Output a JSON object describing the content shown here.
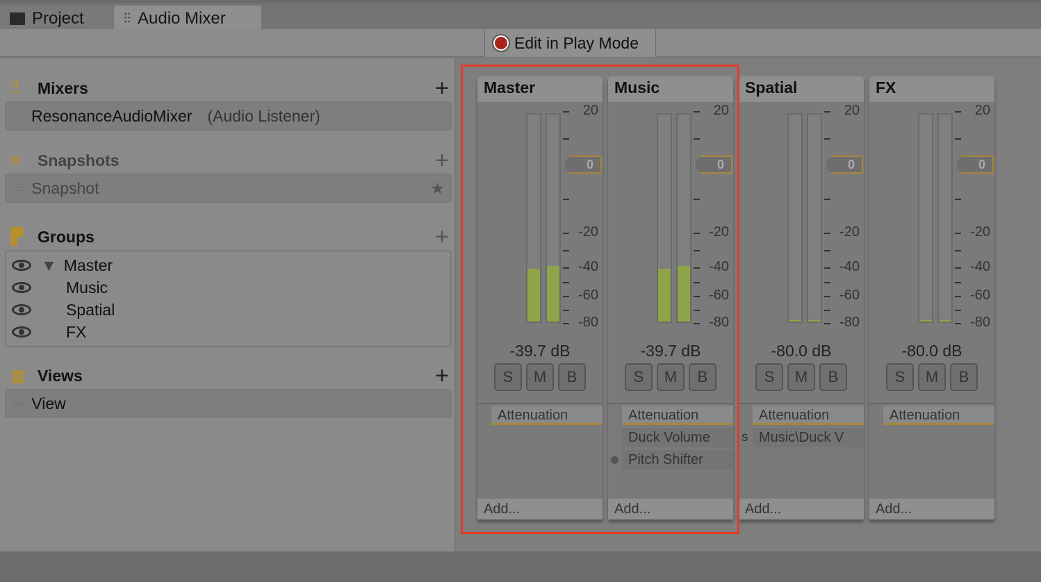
{
  "tabs": [
    {
      "label": "Project",
      "icon": "folder-icon"
    },
    {
      "label": "Audio Mixer",
      "icon": "mixer-icon"
    }
  ],
  "toolbar": {
    "edit_in_play_mode": "Edit in Play Mode"
  },
  "sidebar": {
    "mixers": {
      "title": "Mixers",
      "items": [
        {
          "name": "ResonanceAudioMixer",
          "note": "(Audio Listener)"
        }
      ]
    },
    "snapshots": {
      "title": "Snapshots",
      "items": [
        {
          "name": "Snapshot"
        }
      ]
    },
    "groups": {
      "title": "Groups",
      "items": [
        "Master",
        "Music",
        "Spatial",
        "FX"
      ]
    },
    "views": {
      "title": "Views",
      "items": [
        {
          "name": "View"
        }
      ]
    }
  },
  "scale": {
    "labels": [
      "20",
      "0",
      "-20",
      "-40",
      "-60",
      "-80"
    ]
  },
  "strips": [
    {
      "name": "Master",
      "db_text": "-39.7 dB",
      "fader": "0",
      "meter_db": [
        -42,
        -40
      ],
      "effects": [
        "Attenuation"
      ],
      "send": "",
      "add": "Add...",
      "selected": true
    },
    {
      "name": "Music",
      "db_text": "-39.7 dB",
      "fader": "0",
      "meter_db": [
        -42,
        -40
      ],
      "effects": [
        "Attenuation",
        "Duck Volume",
        "Pitch Shifter"
      ],
      "send": "",
      "add": "Add...",
      "selected": true
    },
    {
      "name": "Spatial",
      "db_text": "-80.0 dB",
      "fader": "0",
      "meter_db": [
        -79,
        -79
      ],
      "effects": [
        "Attenuation",
        "Music\\Duck V"
      ],
      "send": "s",
      "add": "Add...",
      "selected": false
    },
    {
      "name": "FX",
      "db_text": "-80.0 dB",
      "fader": "0",
      "meter_db": [
        -79,
        -79
      ],
      "effects": [
        "Attenuation"
      ],
      "send": "",
      "add": "Add...",
      "selected": false
    }
  ],
  "buttons": [
    "S",
    "M",
    "B"
  ],
  "colors": {
    "meter": "#8ea448",
    "accent": "#a8863a",
    "highlight": "#e53a2a"
  }
}
